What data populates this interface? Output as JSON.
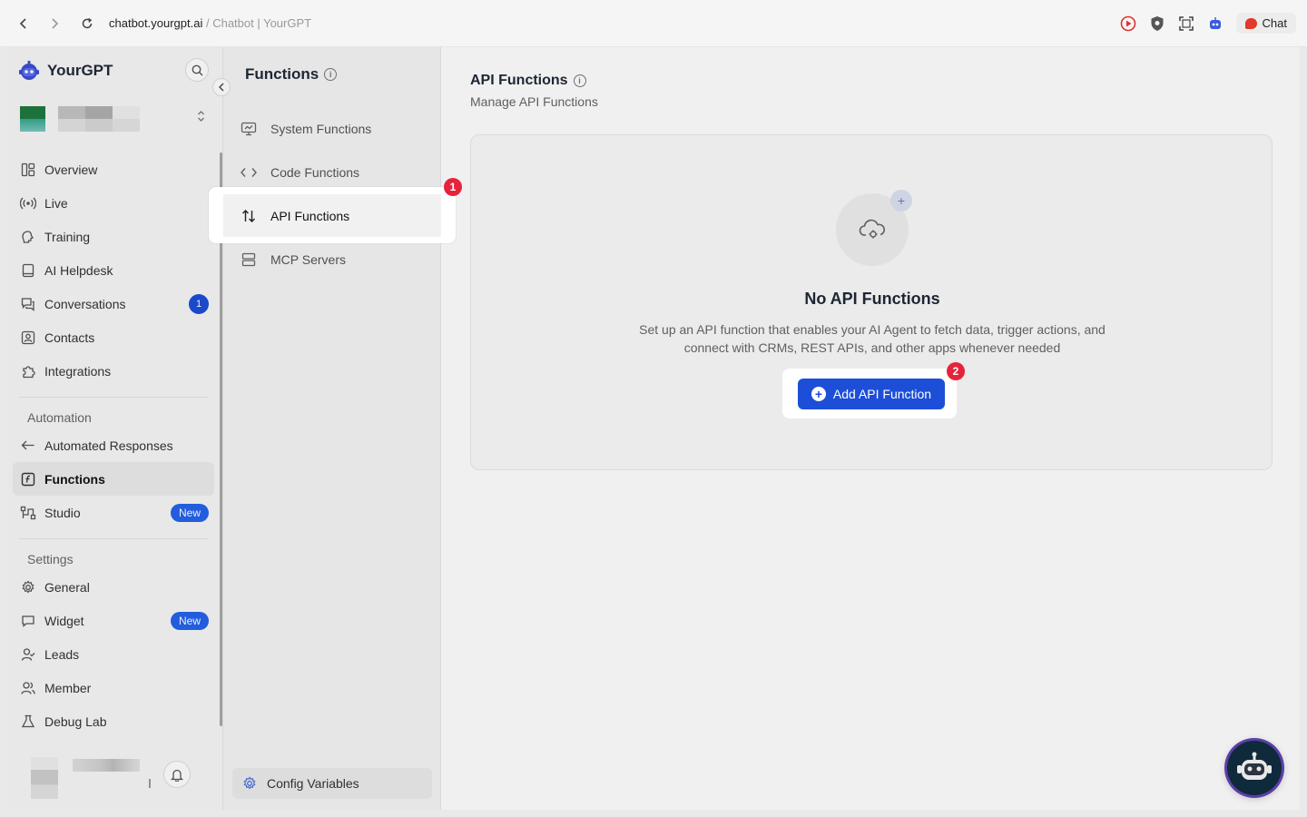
{
  "browser": {
    "url": "chatbot.yourgpt.ai",
    "separator": " / ",
    "title": "Chatbot | YourGPT",
    "chat_label": "Chat"
  },
  "brand": {
    "name": "YourGPT"
  },
  "sidebar": {
    "items": [
      {
        "label": "Overview",
        "icon": "layout-icon"
      },
      {
        "label": "Live",
        "icon": "broadcast-icon"
      },
      {
        "label": "Training",
        "icon": "brain-icon"
      },
      {
        "label": "AI Helpdesk",
        "icon": "book-icon"
      },
      {
        "label": "Conversations",
        "icon": "chat-icon",
        "badge": "1"
      },
      {
        "label": "Contacts",
        "icon": "contact-icon"
      },
      {
        "label": "Integrations",
        "icon": "puzzle-icon"
      }
    ],
    "automation_label": "Automation",
    "automation_items": [
      {
        "label": "Automated Responses",
        "icon": "reply-icon"
      },
      {
        "label": "Functions",
        "icon": "function-icon",
        "active": true
      },
      {
        "label": "Studio",
        "icon": "studio-icon",
        "badge_new": "New"
      }
    ],
    "settings_label": "Settings",
    "settings_items": [
      {
        "label": "General",
        "icon": "gear-icon"
      },
      {
        "label": "Widget",
        "icon": "widget-icon",
        "badge_new": "New"
      },
      {
        "label": "Leads",
        "icon": "leads-icon"
      },
      {
        "label": "Member",
        "icon": "member-icon"
      },
      {
        "label": "Debug Lab",
        "icon": "flask-icon"
      }
    ]
  },
  "functions_panel": {
    "title": "Functions",
    "items": [
      {
        "label": "System Functions",
        "icon": "monitor-icon"
      },
      {
        "label": "Code Functions",
        "icon": "code-icon"
      },
      {
        "label": "API Functions",
        "icon": "arrows-updown-icon",
        "active": true
      },
      {
        "label": "MCP Servers",
        "icon": "server-icon"
      }
    ],
    "config_label": "Config Variables"
  },
  "main": {
    "title": "API Functions",
    "subtitle": "Manage API Functions",
    "empty_title": "No API Functions",
    "empty_desc": "Set up an API function that enables your AI Agent to fetch data, trigger actions, and connect with CRMs, REST APIs, and other apps whenever needed",
    "add_button": "Add API Function"
  },
  "steps": {
    "one": "1",
    "two": "2"
  },
  "colors": {
    "accent": "#1d4ed8",
    "step": "#e5243b"
  }
}
